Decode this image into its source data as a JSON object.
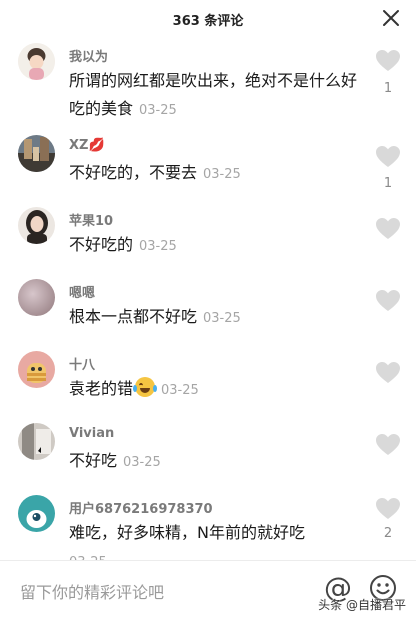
{
  "header": {
    "title": "363 条评论"
  },
  "comments": [
    {
      "user": "我以为",
      "text": "所谓的网红都是吹出来，绝对不是什么好吃的美食",
      "date": "03-25",
      "likes": "1"
    },
    {
      "user": "XZ💋",
      "text": "不好吃的，不要去",
      "date": "03-25",
      "likes": "1"
    },
    {
      "user": "苹果10",
      "text": "不好吃的",
      "date": "03-25",
      "likes": ""
    },
    {
      "user": "嗯嗯",
      "text": "根本一点都不好吃",
      "date": "03-25",
      "likes": ""
    },
    {
      "user": "十八",
      "text": "袁老的错",
      "date": "03-25",
      "likes": ""
    },
    {
      "user": "Vivian",
      "text": "不好吃",
      "date": "03-25",
      "likes": ""
    },
    {
      "user": "用户6876216978370",
      "text": "难吃，好多味精，N年前的就好吃",
      "date": "03-25",
      "likes": "2"
    }
  ],
  "bottom": {
    "placeholder": "留下你的精彩评论吧",
    "at_symbol": "@"
  },
  "watermark": "头条 @自播君平",
  "icons": {
    "close": "close-icon",
    "like": "heart-icon",
    "at": "at-icon",
    "emoji": "smile-icon",
    "reaction": "crying-laughing-emoji"
  }
}
